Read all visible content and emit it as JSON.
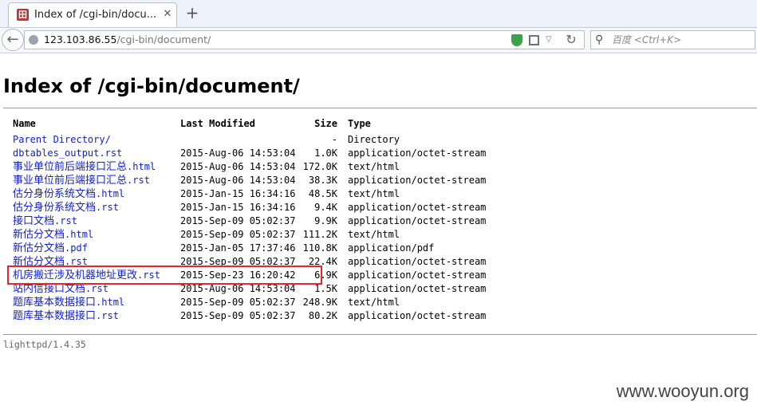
{
  "browser": {
    "tab_title": "Index of /cgi-bin/docu...",
    "tab_favicon_glyph": "田",
    "tab_close_glyph": "✕",
    "new_tab_glyph": "+",
    "back_glyph": "←",
    "url_host": "123.103.86.55",
    "url_path": "/cgi-bin/document/",
    "reload_glyph": "↻",
    "dropdown_glyph": "▽",
    "search_glyph": "⚲",
    "search_placeholder": "百度 <Ctrl+K>",
    "icons": [
      "globe-icon",
      "shield-icon",
      "qr-code-icon",
      "dropdown-icon",
      "reload-icon",
      "search-icon"
    ]
  },
  "page": {
    "title": "Index of /cgi-bin/document/",
    "headers": {
      "name": "Name",
      "modified": "Last Modified",
      "size": "Size",
      "type": "Type"
    },
    "rows": [
      {
        "name": "Parent Directory/",
        "modified": "",
        "size": "-",
        "type": "Directory"
      },
      {
        "name": "dbtables_output.rst",
        "modified": "2015-Aug-06 14:53:04",
        "size": "1.0K",
        "type": "application/octet-stream"
      },
      {
        "name": "事业单位前后端接口汇总.html",
        "modified": "2015-Aug-06 14:53:04",
        "size": "172.0K",
        "type": "text/html"
      },
      {
        "name": "事业单位前后端接口汇总.rst",
        "modified": "2015-Aug-06 14:53:04",
        "size": "38.3K",
        "type": "application/octet-stream"
      },
      {
        "name": "估分身份系统文档.html",
        "modified": "2015-Jan-15 16:34:16",
        "size": "48.5K",
        "type": "text/html"
      },
      {
        "name": "估分身份系统文档.rst",
        "modified": "2015-Jan-15 16:34:16",
        "size": "9.4K",
        "type": "application/octet-stream"
      },
      {
        "name": "接口文档.rst",
        "modified": "2015-Sep-09 05:02:37",
        "size": "9.9K",
        "type": "application/octet-stream"
      },
      {
        "name": "新估分文档.html",
        "modified": "2015-Sep-09 05:02:37",
        "size": "111.2K",
        "type": "text/html"
      },
      {
        "name": "新估分文档.pdf",
        "modified": "2015-Jan-05 17:37:46",
        "size": "110.8K",
        "type": "application/pdf"
      },
      {
        "name": "新估分文档.rst",
        "modified": "2015-Sep-09 05:02:37",
        "size": "22.4K",
        "type": "application/octet-stream"
      },
      {
        "name": "机房搬迁涉及机器地址更改.rst",
        "modified": "2015-Sep-23 16:20:42",
        "size": "6.9K",
        "type": "application/octet-stream"
      },
      {
        "name": "站内信接口文档.rst",
        "modified": "2015-Aug-06 14:53:04",
        "size": "1.5K",
        "type": "application/octet-stream"
      },
      {
        "name": "题库基本数据接口.html",
        "modified": "2015-Sep-09 05:02:37",
        "size": "248.9K",
        "type": "text/html"
      },
      {
        "name": "题库基本数据接口.rst",
        "modified": "2015-Sep-09 05:02:37",
        "size": "80.2K",
        "type": "application/octet-stream"
      }
    ],
    "footer": "lighttpd/1.4.35",
    "watermark": "www.wooyun.org"
  },
  "colors": {
    "link": "#1122cc",
    "highlight": "#e8272b",
    "shield": "#3aa34a"
  }
}
